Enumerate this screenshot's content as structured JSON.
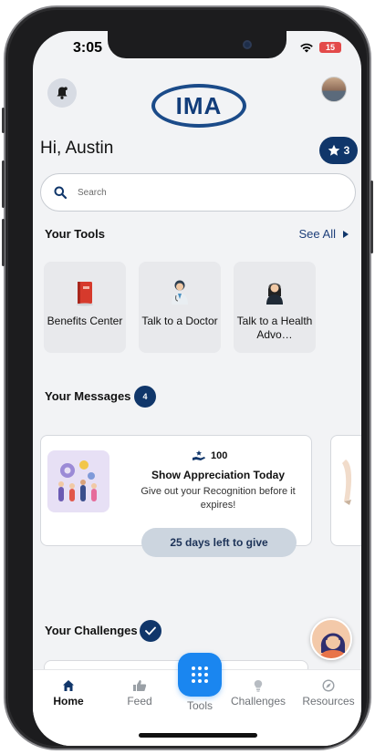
{
  "status": {
    "time": "3:05",
    "battery": "15"
  },
  "header": {
    "logo_text": "IMA",
    "greeting": "Hi, Austin",
    "stars_count": "3"
  },
  "search": {
    "placeholder": "Search"
  },
  "tools": {
    "title": "Your Tools",
    "see_all": "See All",
    "items": [
      {
        "label": "Benefits Center",
        "icon": "book-icon"
      },
      {
        "label": "Talk to a Doctor",
        "icon": "doctor-icon"
      },
      {
        "label": "Talk to a Health Advo…",
        "icon": "advocate-icon"
      }
    ]
  },
  "messages": {
    "title": "Your Messages",
    "count": "4",
    "card": {
      "points": "100",
      "title": "Show Appreciation Today",
      "description": "Give out your Recognition before it expires!",
      "button": "25 days left to give"
    }
  },
  "challenges": {
    "title": "Your Challenges"
  },
  "tabbar": {
    "items": [
      {
        "label": "Home",
        "icon": "home-icon"
      },
      {
        "label": "Feed",
        "icon": "thumbs-up-icon"
      },
      {
        "label": "Tools",
        "icon": "grid-icon"
      },
      {
        "label": "Challenges",
        "icon": "lightbulb-icon"
      },
      {
        "label": "Resources",
        "icon": "compass-icon"
      }
    ]
  },
  "colors": {
    "navy": "#10366a",
    "tools_blue": "#1a86f0",
    "background": "#f2f3f5"
  }
}
